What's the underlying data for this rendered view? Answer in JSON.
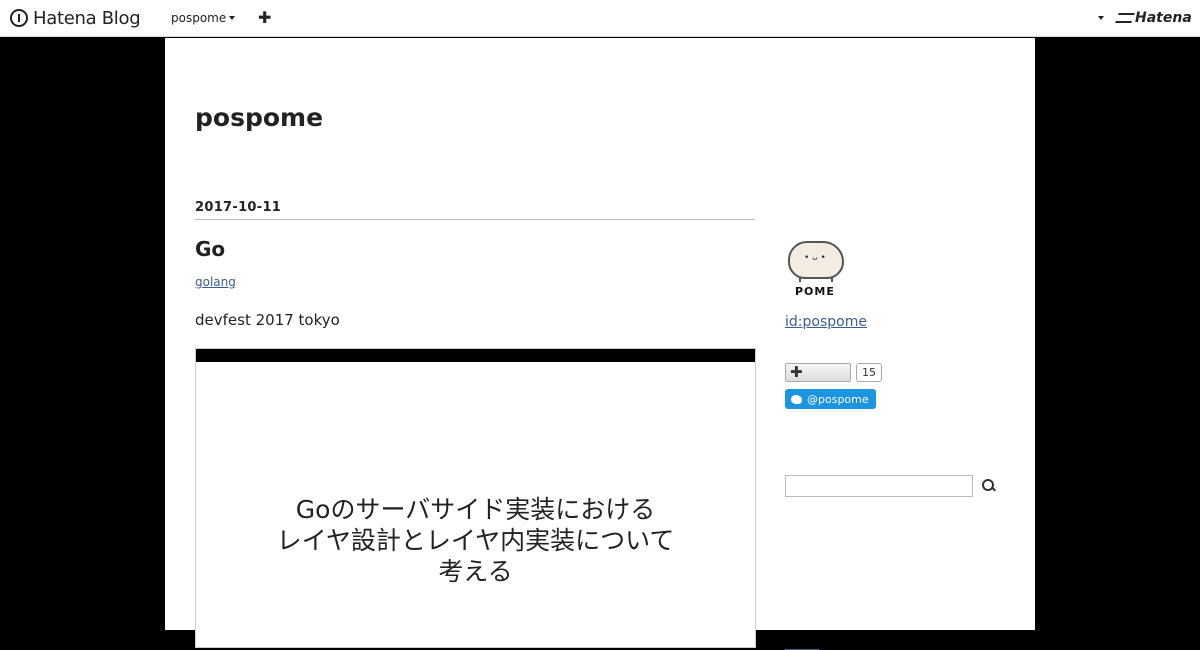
{
  "topbar": {
    "logo_text": "Hatena Blog",
    "blog_name": "pospome",
    "add_icon": "plus-icon",
    "brand": "Hatena"
  },
  "site": {
    "title": "pospome"
  },
  "entry": {
    "date": "2017-10-11",
    "title": "Go",
    "category": "golang",
    "text": "devfest 2017 tokyo",
    "slide_lines": [
      "Goのサーバサイド実装における",
      "レイヤ設計とレイヤ内実装について",
      "考える"
    ]
  },
  "sidebar": {
    "avatar_label": "POME",
    "user_id": "id:pospome",
    "star_count": "15",
    "twitter_label": "@pospome",
    "search_placeholder": ""
  },
  "colors": {
    "background": "#000000",
    "page": "#ffffff",
    "link": "#3b5e8c",
    "twitter": "#1b95e0"
  }
}
